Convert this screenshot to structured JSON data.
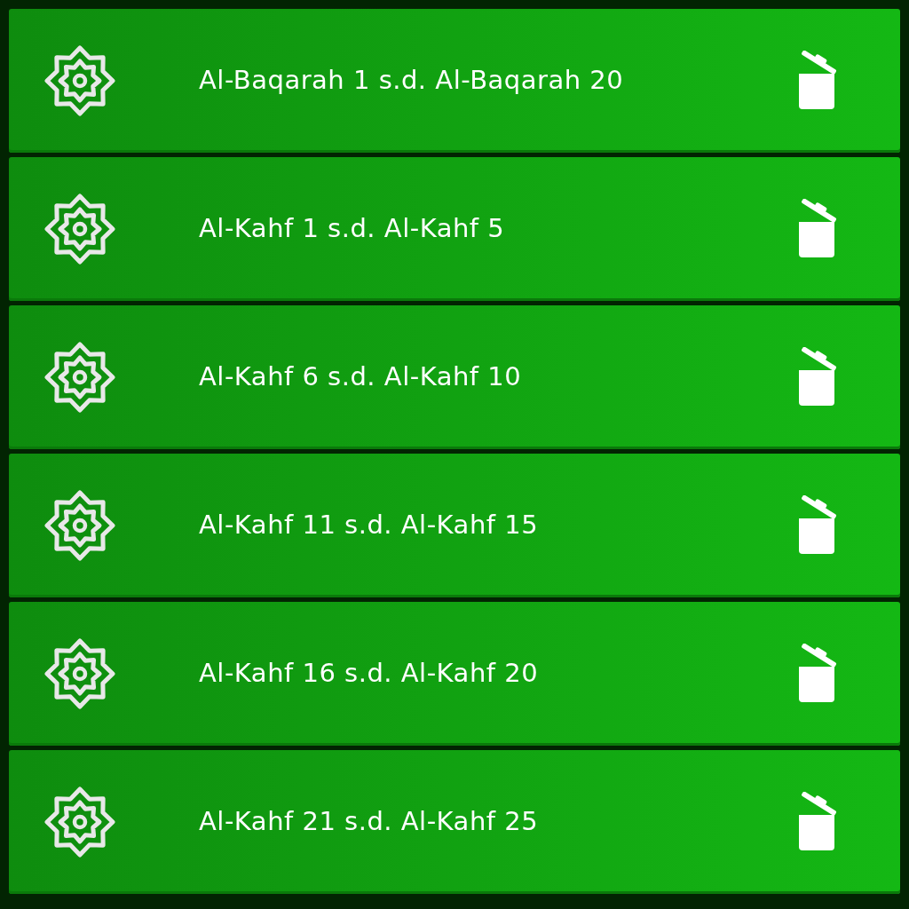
{
  "items": [
    {
      "label": "Al-Baqarah 1 s.d. Al-Baqarah 20"
    },
    {
      "label": "Al-Kahf 1 s.d. Al-Kahf 5"
    },
    {
      "label": "Al-Kahf 6 s.d. Al-Kahf 10"
    },
    {
      "label": "Al-Kahf 11 s.d. Al-Kahf 15"
    },
    {
      "label": "Al-Kahf 16 s.d. Al-Kahf 20"
    },
    {
      "label": "Al-Kahf 21 s.d. Al-Kahf 25"
    }
  ]
}
